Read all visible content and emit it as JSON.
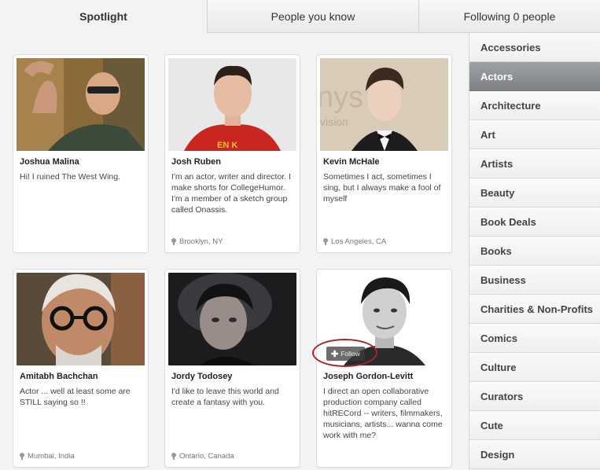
{
  "tabs": [
    {
      "label": "Spotlight"
    },
    {
      "label": "People you know"
    },
    {
      "label": "Following 0 people"
    }
  ],
  "people": [
    {
      "name": "Joshua Malina",
      "bio": "Hi! I ruined The West Wing.",
      "location": ""
    },
    {
      "name": "Josh Ruben",
      "bio": "I'm an actor, writer and director. I make shorts for CollegeHumor. I'm a member of a sketch group called Onassis.",
      "location": "Brooklyn, NY"
    },
    {
      "name": "Kevin McHale",
      "bio": "Sometimes I act, sometimes I sing, but I always make a fool of myself",
      "location": "Los Angeles, CA"
    },
    {
      "name": "Amitabh Bachchan",
      "bio": "Actor ... well at least some are STILL saying so !!",
      "location": "Mumbai, India"
    },
    {
      "name": "Jordy Todosey",
      "bio": "I'd like to leave this world and create a fantasy with you.",
      "location": "Ontario, Canada"
    },
    {
      "name": "Joseph Gordon-Levitt",
      "bio": "I direct an open collaborative production company called hitRECord -- writers, filmmakers, musicians, artists... wanna come work with me?",
      "location": ""
    }
  ],
  "follow_button": {
    "label": "Follow"
  },
  "categories": [
    {
      "label": "Accessories"
    },
    {
      "label": "Actors"
    },
    {
      "label": "Architecture"
    },
    {
      "label": "Art"
    },
    {
      "label": "Artists"
    },
    {
      "label": "Beauty"
    },
    {
      "label": "Book Deals"
    },
    {
      "label": "Books"
    },
    {
      "label": "Business"
    },
    {
      "label": "Charities & Non-Profits"
    },
    {
      "label": "Comics"
    },
    {
      "label": "Culture"
    },
    {
      "label": "Curators"
    },
    {
      "label": "Cute"
    },
    {
      "label": "Design"
    }
  ],
  "active_category": "Actors",
  "colors": {
    "highlight_ring": "#a8232a",
    "active_category_bg": "#8f9297"
  }
}
